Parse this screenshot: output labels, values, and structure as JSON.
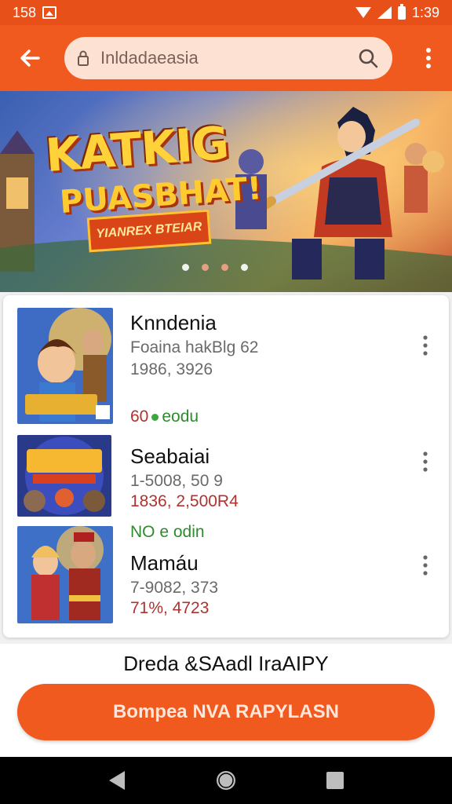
{
  "status_bar": {
    "time_left": "158",
    "time_right": "1:39"
  },
  "toolbar": {
    "search_value": "Inldadaeasia"
  },
  "banner": {
    "title": "KATKIG",
    "subtitle": "PUASBHAT!",
    "ribbon": "YIANREX BTEIAR"
  },
  "list": {
    "items": [
      {
        "title": "Knndenia",
        "line1": "Foaina hakBlg 62",
        "line2": "1986, 3926",
        "badge_num": "60",
        "badge_text": "eodu"
      },
      {
        "title": "Seabaiai",
        "line1": "1-5008, 50 9",
        "line2": "1836, 2,500R4"
      },
      {
        "badge_text": "NO e odin",
        "title": "Mamáu",
        "line1": "7-9082, 373",
        "line2": "71%, 4723"
      }
    ]
  },
  "footer": {
    "caption": "Dreda &SAadl IraAIPY",
    "cta_label": "Bompea NVA RAPYLASN"
  },
  "colors": {
    "accent": "#f05a1f",
    "status_bar": "#e8501a"
  }
}
